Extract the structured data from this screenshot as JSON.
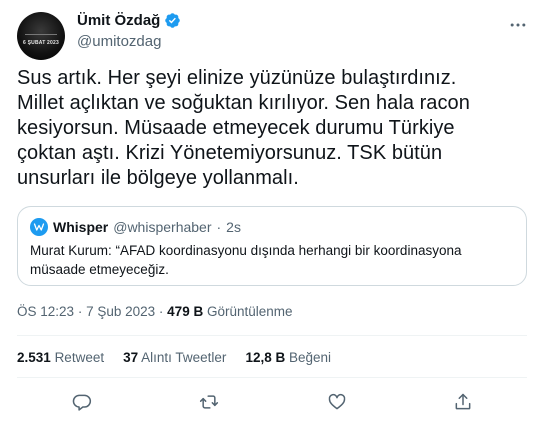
{
  "author": {
    "display_name": "Ümit Özdağ",
    "handle": "@umitozdag",
    "avatar_text": "6 ŞUBAT 2023",
    "verified_icon": "verified-badge-icon"
  },
  "tweet": {
    "lines": [
      "Sus artık. Her şeyi elinize yüzünüze bulaştırdınız.",
      "Millet açlıktan ve soğuktan kırılıyor. Sen hala racon",
      "kesiyorsun. Müsaade etmeyecek durumu Türkiye",
      "çoktan aştı. Krizi Yönetemiyorsunuz. TSK bütün",
      "unsurları ile bölgeye yollanmalı."
    ]
  },
  "quote": {
    "name": "Whisper",
    "handle": "@whisperhaber",
    "separator": "·",
    "time": "2s",
    "lines": [
      "Murat Kurum: “AFAD koordinasyonu dışında herhangi bir koordinasyona",
      "müsaade etmeyeceğiz."
    ]
  },
  "meta": {
    "time": "ÖS 12:23",
    "separator": "·",
    "date": "7 Şub 2023",
    "views_count": "479 B",
    "views_label": "Görüntülenme"
  },
  "stats": {
    "retweets_count": "2.531",
    "retweets_label": "Retweet",
    "quotes_count": "37",
    "quotes_label": "Alıntı Tweetler",
    "likes_count": "12,8 B",
    "likes_label": "Beğeni"
  },
  "actions": [
    "reply-icon",
    "retweet-icon",
    "like-icon",
    "share-icon"
  ],
  "colors": {
    "accent": "#1d9bf0",
    "text": "#0f1419",
    "muted": "#536471",
    "border": "#cfd9de"
  }
}
